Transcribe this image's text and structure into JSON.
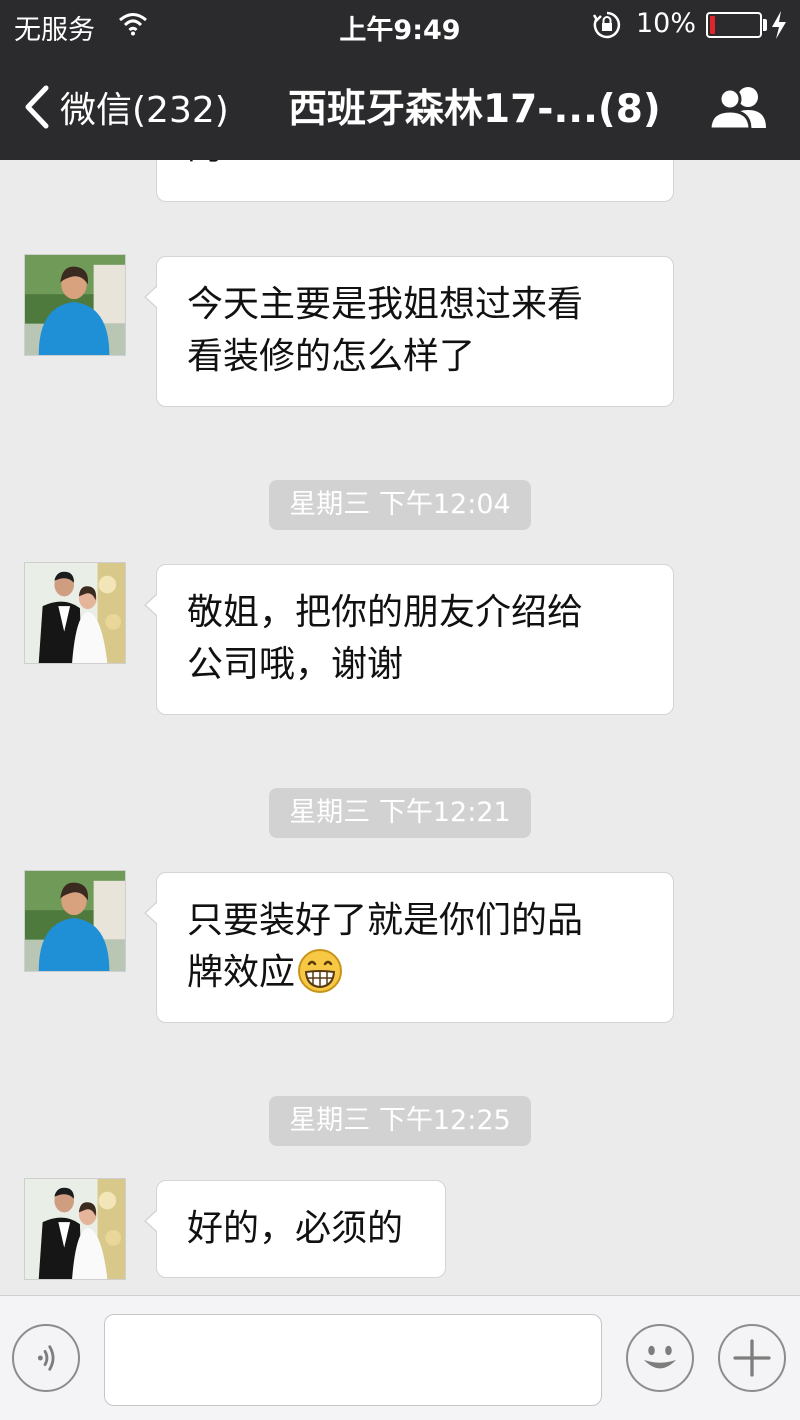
{
  "status_bar": {
    "carrier": "无服务",
    "time": "上午9:49",
    "battery": "10%",
    "battery_level": 0.1,
    "icons": [
      "wifi-icon",
      "rotation-lock-icon",
      "battery-icon",
      "charging-bolt-icon"
    ]
  },
  "nav": {
    "back_label": "微信(232)",
    "title": "西班牙森林17-...(8)",
    "icons": [
      "chevron-left-icon",
      "group-members-icon"
    ]
  },
  "messages": [
    {
      "type": "text",
      "text": "的",
      "partial": true
    },
    {
      "type": "text",
      "text_lines": [
        "今天主要是我姐想过来看",
        "看装修的怎么样了"
      ]
    },
    {
      "type": "timestamp",
      "text": "星期三 下午12:04"
    },
    {
      "type": "text",
      "text_lines": [
        "敬姐，把你的朋友介绍给",
        "公司哦，谢谢"
      ]
    },
    {
      "type": "timestamp",
      "text": "星期三 下午12:21"
    },
    {
      "type": "text",
      "text_lines": [
        "只要装好了就是你们的品",
        "牌效应"
      ],
      "emoji": "grinning-face-icon"
    },
    {
      "type": "timestamp",
      "text": "星期三 下午12:25"
    },
    {
      "type": "text",
      "text_lines": [
        "好的，必须的"
      ]
    }
  ],
  "input_bar": {
    "value": "",
    "icons": [
      "voice-icon",
      "emoji-icon",
      "plus-icon"
    ]
  },
  "colors": {
    "header_bg": "#2b2b2d",
    "chat_bg": "#ebebeb",
    "bubble_bg": "#ffffff",
    "timestamp_bg": "#d2d2d2",
    "battery_low": "#e0262c"
  }
}
